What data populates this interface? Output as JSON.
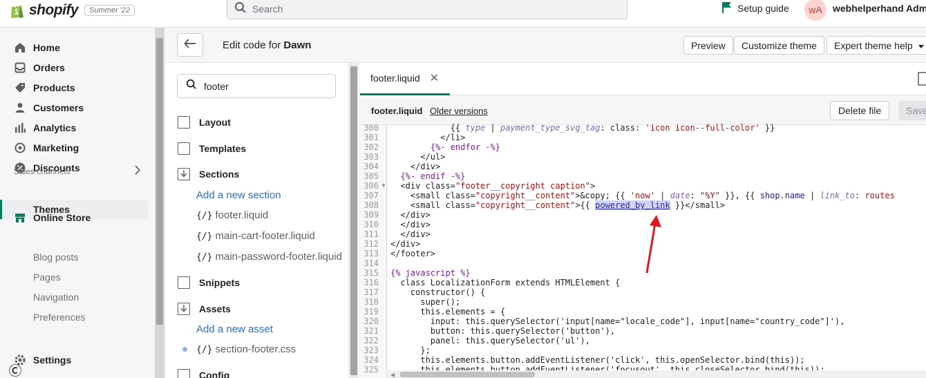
{
  "topbar": {
    "brand": "shopify",
    "edition": "Summer '22",
    "search_placeholder": "Search",
    "setup_guide": "Setup guide",
    "avatar_initials": "wA",
    "username": "webhelperhand Admi"
  },
  "nav": {
    "items": [
      "Home",
      "Orders",
      "Products",
      "Customers",
      "Analytics",
      "Marketing",
      "Discounts"
    ],
    "sales_channels": "Sales channels",
    "online_store": "Online Store",
    "sub_items": [
      "Themes",
      "Blog posts",
      "Pages",
      "Navigation",
      "Preferences"
    ],
    "settings": "Settings"
  },
  "header": {
    "title_prefix": "Edit code for",
    "theme_name": "Dawn",
    "preview": "Preview",
    "customize": "Customize theme",
    "expert_help": "Expert theme help"
  },
  "tree": {
    "search_value": "footer",
    "folders": [
      "Layout",
      "Templates",
      "Sections",
      "Snippets",
      "Assets",
      "Config"
    ],
    "add_section": "Add a new section",
    "section_files": [
      "footer.liquid",
      "main-cart-footer.liquid",
      "main-password-footer.liquid"
    ],
    "add_asset": "Add a new asset",
    "asset_files": [
      "section-footer.css"
    ],
    "file_icon": "{/}"
  },
  "editor": {
    "tab_label": "footer.liquid",
    "file_name": "footer.liquid",
    "older_versions": "Older versions",
    "delete_file": "Delete file",
    "save": "Save",
    "line_numbers": [
      "300",
      "301",
      "302",
      "303",
      "304",
      "305",
      "306",
      "307",
      "308",
      "309",
      "310",
      "311",
      "312",
      "313",
      "314",
      "315",
      "316",
      "317",
      "318",
      "319",
      "320",
      "321",
      "322",
      "323",
      "324",
      "325"
    ]
  },
  "colors": {
    "accent": "#008060",
    "link": "#2c6ecb",
    "arrow": "#e0191f"
  }
}
